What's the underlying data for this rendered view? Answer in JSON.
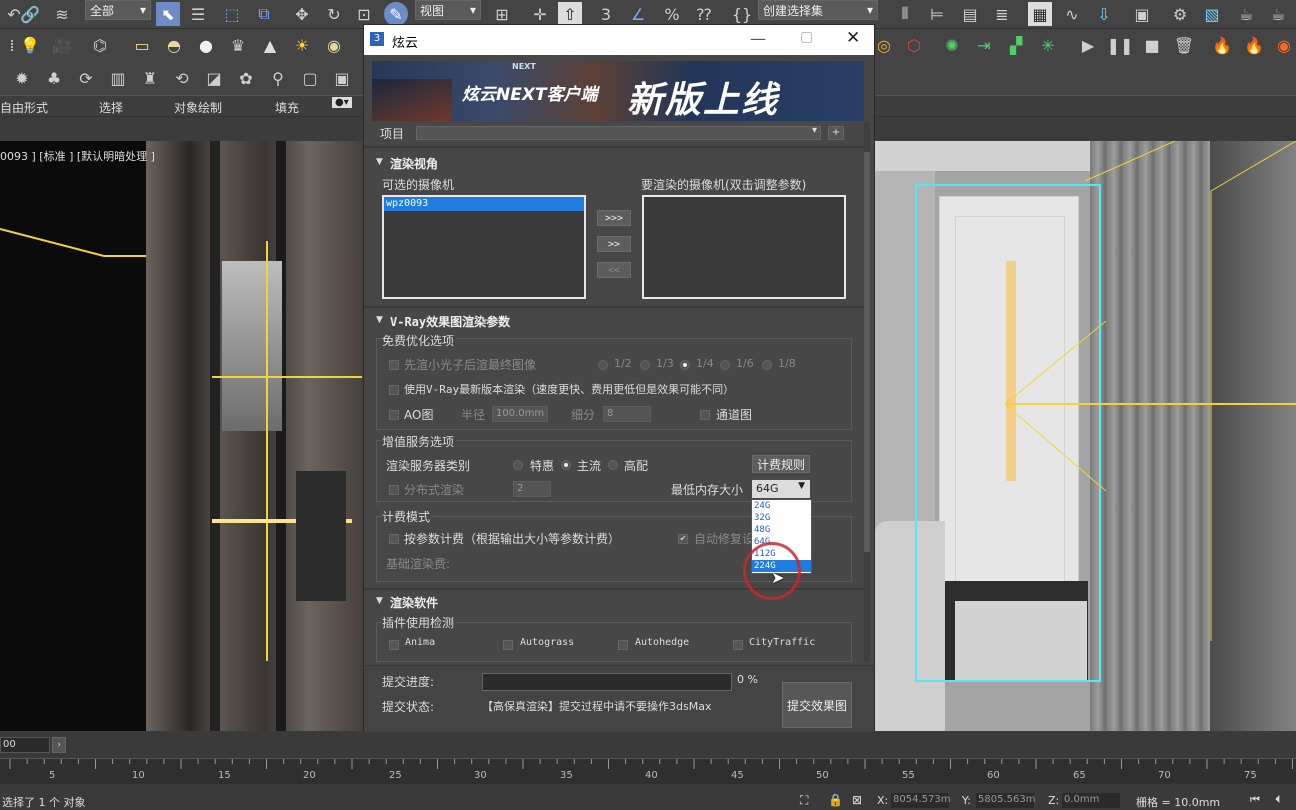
{
  "toolbar": {
    "selection_filter": "全部",
    "view_ref": "视图",
    "named_selection": "创建选择集"
  },
  "ribbon": {
    "tabs": [
      "自由形式",
      "选择",
      "对象绘制",
      "填充"
    ]
  },
  "viewport": {
    "label": "0093 ] [标准 ] [默认明暗处理 ]"
  },
  "dialog": {
    "title": "炫云",
    "banner": {
      "brand": "炫云NEXT客户端",
      "headline": "新版上线",
      "small": "NEXT"
    },
    "project_label": "项目",
    "camera_section": {
      "title": "渲染视角",
      "available_label": "可选的摄像机",
      "render_label": "要渲染的摄像机(双击调整参数)",
      "available": [
        "wpz0093"
      ],
      "btn_all": ">>>",
      "btn_add": ">>",
      "btn_remove": "<<"
    },
    "vray_section": {
      "title": "V-Ray效果图渲染参数",
      "free_opt": {
        "title": "免费优化选项",
        "prepass_label": "先渲小光子后渲最终图像",
        "fractions": [
          "1/2",
          "1/3",
          "1/4",
          "1/6",
          "1/8"
        ],
        "selected_fraction": "1/4",
        "latest_vray": "使用V-Ray最新版本渲染（速度更快、费用更低但是效果可能不同）",
        "ao_label": "AO图",
        "radius_label": "半径",
        "radius_value": "100.0mm",
        "subdiv_label": "细分",
        "subdiv_value": "8",
        "channel_label": "通道图"
      },
      "value_opt": {
        "title": "增值服务选项",
        "server_type_label": "渲染服务器类别",
        "server_types": [
          "特惠",
          "主流",
          "高配"
        ],
        "selected_server": "主流",
        "billing_rules_btn": "计费规则",
        "distributed_label": "分布式渲染",
        "distributed_value": "2",
        "min_mem_label": "最低内存大小",
        "min_mem_value": "64G",
        "mem_options": [
          "24G",
          "32G",
          "48G",
          "64G",
          "112G",
          "224G"
        ],
        "mem_highlight": "224G"
      },
      "billing": {
        "title": "计费模式",
        "by_param": "按参数计费（根据输出大小等参数计费）",
        "auto_fix": "自动修复设",
        "base_fee": "基础渲染费:"
      }
    },
    "software_section": {
      "title": "渲染软件",
      "plugin_title": "插件使用检测",
      "plugins": [
        "Anima",
        "Autograss",
        "Autohedge",
        "CityTraffic"
      ]
    },
    "submit": {
      "progress_label": "提交进度:",
      "progress_value": "0 %",
      "progress_fraction": 0,
      "status_label": "提交状态:",
      "status_value": "【高保真渲染】提交过程中请不要操作3dsMax",
      "submit_btn": "提交效果图"
    }
  },
  "timeline": {
    "frame_field": "00",
    "ticks": [
      "5",
      "10",
      "15",
      "20",
      "25",
      "30",
      "35",
      "40",
      "45",
      "50",
      "55",
      "60",
      "65",
      "70",
      "75"
    ]
  },
  "status": {
    "selected": "选择了 1 个 对象",
    "x_label": "X:",
    "x_value": "8054.573m",
    "y_label": "Y:",
    "y_value": "5805.563m",
    "z_label": "Z:",
    "z_value": "0.0mm",
    "grid": "栅格 = 10.0mm"
  }
}
